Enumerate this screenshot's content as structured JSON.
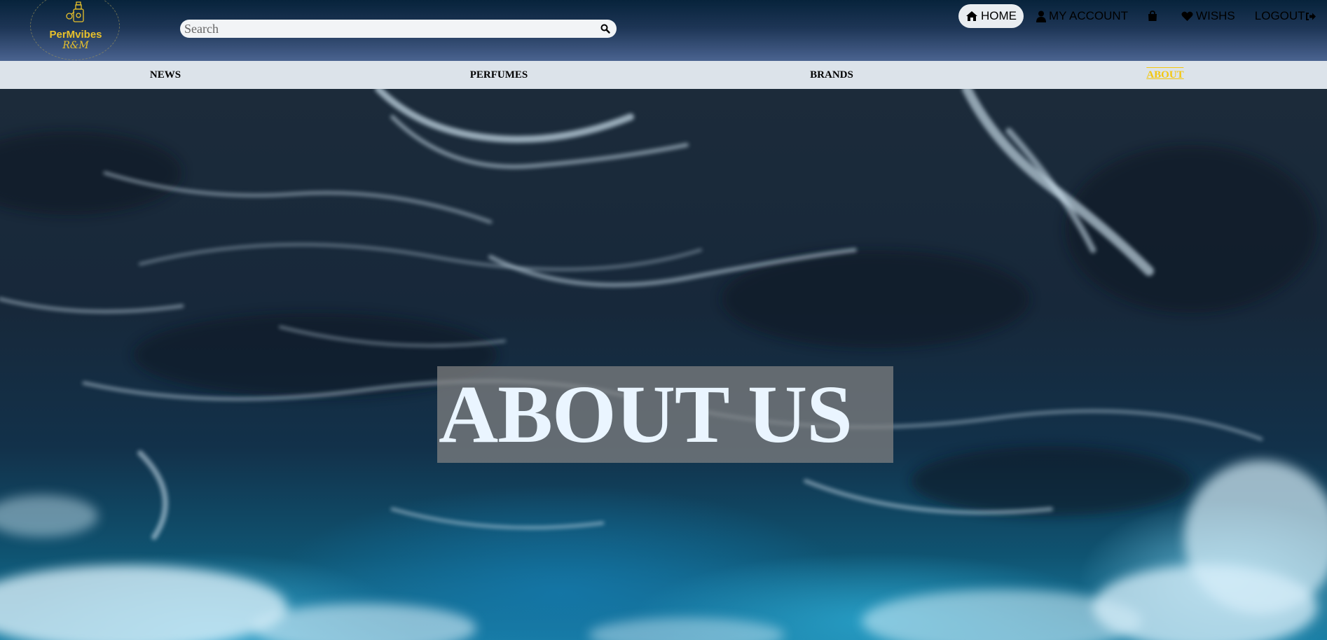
{
  "brand": {
    "name_line1": "PerMvibes",
    "name_line2": "R&M",
    "accent": "#e8c12b"
  },
  "search": {
    "placeholder": "Search",
    "icon": "search-icon"
  },
  "top_nav": {
    "home": "HOME",
    "account": "MY ACCOUNT",
    "wishes": "WISHS",
    "logout": "LOGOUT",
    "icons": [
      "home-icon",
      "user-icon",
      "shopping-bag-icon",
      "heart-icon",
      "sign-out-icon"
    ]
  },
  "categories": {
    "news": "NEWS",
    "perfumes": "PERFUMES",
    "brands": "BRANDS",
    "about": "ABOUT",
    "active": "about",
    "active_color": "#f3c70e"
  },
  "hero": {
    "title": "ABOUT US"
  }
}
